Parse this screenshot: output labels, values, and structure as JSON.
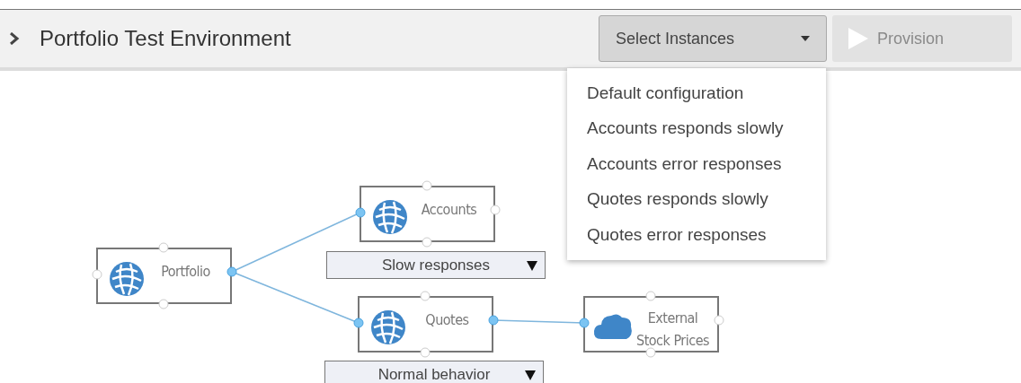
{
  "header": {
    "title": "Portfolio Test Environment",
    "expanded": false
  },
  "instances_select": {
    "label": "Select Instances",
    "expanded": true,
    "options": [
      "Default configuration",
      "Accounts responds slowly",
      "Accounts error responses",
      "Quotes responds slowly",
      "Quotes error responses"
    ]
  },
  "provision_button": {
    "label": "Provision",
    "disabled": true
  },
  "nodes": [
    {
      "kind": "service",
      "label": "Portfolio"
    },
    {
      "kind": "service",
      "label": "Accounts",
      "behavior": "Slow responses"
    },
    {
      "kind": "service",
      "label": "Quotes",
      "behavior": "Normal behavior"
    },
    {
      "kind": "external",
      "label": "External Stock Prices"
    }
  ]
}
